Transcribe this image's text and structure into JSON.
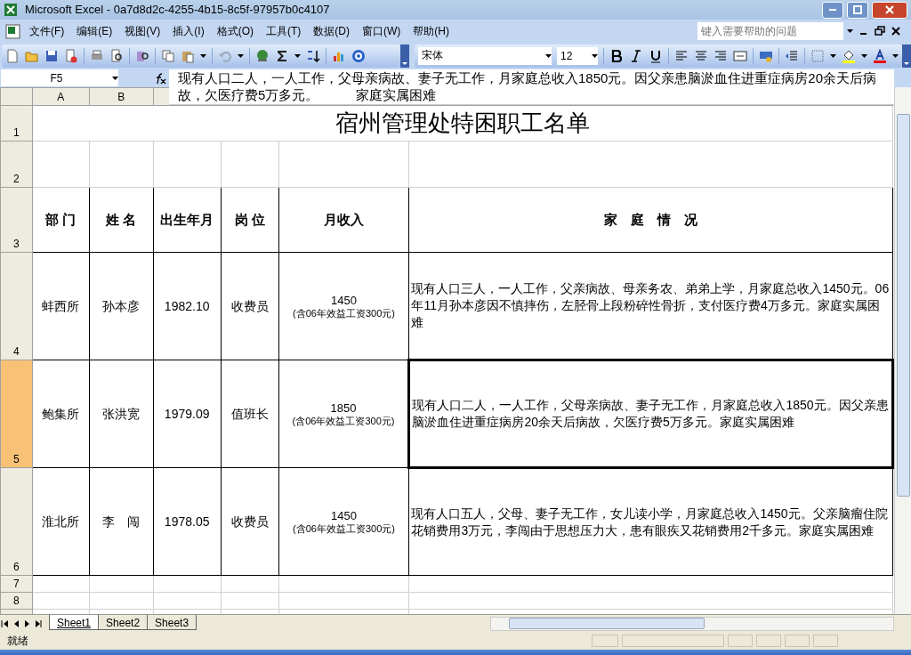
{
  "window": {
    "title": "Microsoft Excel - 0a7d8d2c-4255-4b15-8c5f-97957b0c4107"
  },
  "menu": [
    "文件(F)",
    "编辑(E)",
    "视图(V)",
    "插入(I)",
    "格式(O)",
    "工具(T)",
    "数据(D)",
    "窗口(W)",
    "帮助(H)"
  ],
  "help_box": {
    "placeholder": "键入需要帮助的问题"
  },
  "font_box": {
    "value": "宋体"
  },
  "size_box": {
    "value": "12"
  },
  "name_box": {
    "value": "F5"
  },
  "formula_bar": {
    "value": "现有人口二人，一人工作，父母亲病故、妻子无工作，月家庭总收入1850元。因父亲患脑淤血住进重症病房20余天后病故，欠医疗费5万多元。          家庭实属困难"
  },
  "column_headers": [
    "A",
    "B"
  ],
  "rows": [
    {
      "row": "1",
      "kind": "title",
      "text": "宿州管理处特困职工名单"
    },
    {
      "row": "2",
      "kind": "blank"
    },
    {
      "row": "3",
      "kind": "header",
      "cells": [
        "部 门",
        "姓 名",
        "出生年月",
        "岗 位",
        "月收入",
        "家　庭　情　况"
      ]
    },
    {
      "row": "4",
      "kind": "record",
      "selected": false,
      "cells": [
        "蚌西所",
        "孙本彦",
        "1982.10",
        "收费员"
      ],
      "income": "1450",
      "income_note": "(含06年效益工资300元)",
      "family": "现有人口三人，一人工作，父亲病故、母亲务农、弟弟上学，月家庭总收入1450元。06年11月孙本彦因不慎摔伤，左胫骨上段粉碎性骨折，支付医疗费4万多元。家庭实属困难"
    },
    {
      "row": "5",
      "kind": "record",
      "selected": true,
      "cells": [
        "鲍集所",
        "张洪宽",
        "1979.09",
        "值班长"
      ],
      "income": "1850",
      "income_note": "(含06年效益工资300元)",
      "family": "现有人口二人，一人工作，父母亲病故、妻子无工作，月家庭总收入1850元。因父亲患脑淤血住进重症病房20余天后病故，欠医疗费5万多元。家庭实属困难"
    },
    {
      "row": "6",
      "kind": "record",
      "selected": false,
      "cells": [
        "淮北所",
        "李　闯",
        "1978.05",
        "收费员"
      ],
      "income": "1450",
      "income_note": "(含06年效益工资300元)",
      "family": "现有人口五人，父母、妻子无工作，女儿读小学，月家庭总收入1450元。父亲脑瘤住院花销费用3万元，李闯由于思想压力大，患有眼疾又花销费用2千多元。家庭实属困难"
    },
    {
      "row": "7",
      "kind": "blank"
    },
    {
      "row": "8",
      "kind": "blank"
    }
  ],
  "sheet_tabs": [
    {
      "label": "Sheet1",
      "selected": true
    },
    {
      "label": "Sheet2",
      "selected": false
    },
    {
      "label": "Sheet3",
      "selected": false
    }
  ],
  "status_bar": {
    "text": "就绪"
  }
}
